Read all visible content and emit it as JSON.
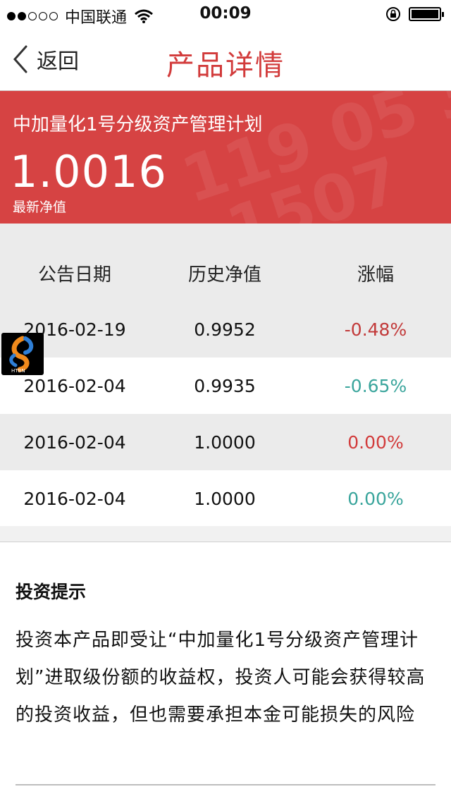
{
  "status_bar": {
    "carrier": "中国联通",
    "time": "00:09"
  },
  "nav": {
    "back_label": "返回",
    "title": "产品详情"
  },
  "product": {
    "name": "中加量化1号分级资产管理计划",
    "latest_nav": "1.0016",
    "latest_nav_label": "最新净值"
  },
  "table": {
    "headers": [
      "公告日期",
      "历史净值",
      "涨幅"
    ],
    "rows": [
      {
        "date": "2016-02-19",
        "nav": "0.9952",
        "change": "-0.48%"
      },
      {
        "date": "2016-02-04",
        "nav": "0.9935",
        "change": "-0.65%"
      },
      {
        "date": "2016-02-04",
        "nav": "1.0000",
        "change": "0.00%"
      },
      {
        "date": "2016-02-04",
        "nav": "1.0000",
        "change": "0.00%"
      }
    ]
  },
  "overlay_logo": {
    "text": "HTBN"
  },
  "tips": {
    "title": "投资提示",
    "text": "投资本产品即受让“中加量化1号分级资产管理计划”进取级份额的收益权，投资人可能会获得较高的投资收益，但也需要承担本金可能损失的风险"
  },
  "colors": {
    "accent": "#d23b3b",
    "hero_bg": "#d64343",
    "negative": "#c23a3a",
    "positive": "#3aa59c"
  }
}
